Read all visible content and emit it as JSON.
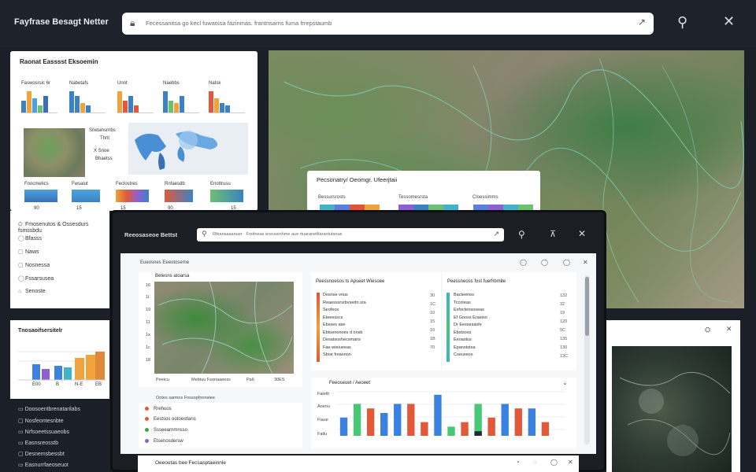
{
  "app": {
    "title": "Fayfrase Besagt Netter"
  },
  "search": {
    "text": "Fecessanitsa go kecl fuwatssa fazinmas. frantnsarns fuma frrepstaumb",
    "arrow": "↗"
  },
  "top_actions": {
    "search": "⚲",
    "close": "✕"
  },
  "left_panel": {
    "title": "Raonat Easssst Eksoemin",
    "mini_charts": [
      {
        "label": "Faswosrsic 6r",
        "colors": [
          "#3b82c4",
          "#f0a33a",
          "#4aa3df",
          "#6cc070",
          "#3b6fb5"
        ]
      },
      {
        "label": "Nabetafs",
        "colors": [
          "#3b82c4",
          "#3b82c4",
          "#f0a33a",
          "#3b82c4"
        ]
      },
      {
        "label": "Unnt",
        "colors": [
          "#f0a33a",
          "#e05a3a",
          "#3b82c4",
          "#e05a3a"
        ]
      },
      {
        "label": "Naebbs",
        "colors": [
          "#3b82c4",
          "#6cc070",
          "#f0a33a",
          "#3b82c4"
        ]
      },
      {
        "label": "Natsk",
        "colors": [
          "#e05a3a",
          "#f0a33a",
          "#3b82c4",
          "#3b82c4"
        ]
      }
    ],
    "map_labels": [
      "Srietansrnbs",
      "Thrit",
      "X Srioe",
      "Bhaetss"
    ],
    "bottom_labels": [
      "Fnocmetics",
      "Fwsalut",
      "Feclostres",
      "Rnfaesdb",
      "Enottrusu"
    ],
    "bottom_values": [
      "90",
      "15",
      "15",
      "90",
      "15"
    ]
  },
  "left_list": {
    "items": [
      "Fmosenutos & Ossesdurs fsmssbdu",
      "Bfasss",
      "Naws",
      "Nosnessa",
      "Fssarsusea",
      "Senoste"
    ],
    "icons": [
      "⛭",
      "◯",
      "▢",
      "▢",
      "◯",
      "⌂"
    ]
  },
  "map_popup": {
    "title": "Pecsonatry/ Oeomgr. Ufeerjtaii",
    "cols": [
      "Bessursrosts",
      "Tessomesrsta",
      "Cloessimms"
    ],
    "bars": [
      [
        "#3fb3c9",
        "#5a7fe0",
        "#e0553a",
        "#f0a33a"
      ],
      [
        "#8f5fd6",
        "#3b82c4",
        "#6cc070",
        "#3fb3c9"
      ],
      [
        "#5a7fe0",
        "#8f5fd6",
        "#3fb3c9",
        "#6cc070"
      ]
    ]
  },
  "bl_card": {
    "title": "Tnosaoifsersitelr",
    "xlabels": [
      "E00",
      "B",
      "N-E",
      "EB"
    ]
  },
  "bl_list": {
    "items": [
      "Doosoentbrenatarilabs",
      "Nosfeontesnbte",
      "Nrfsoeetssuaeobs",
      "Easnsreosstb",
      "Desnemsbessbt",
      "Easnurrfaeoseuot"
    ],
    "icons": [
      "▭",
      "▢",
      "▭",
      "▭",
      "▢",
      "▭"
    ]
  },
  "front_window": {
    "title": "Reeosaseoe Bettst",
    "search_text": "Rfeansaaanuer · Freitneas iesruusnhme aue rtuaranetfiarantutsnue",
    "actions": {
      "search": "⚲",
      "pin": "⊼",
      "close": "✕"
    },
    "breadcrumb": "Eueosnes Eeeotoseme",
    "toolbar_icons": [
      "◯",
      "◯",
      "◯",
      "✕"
    ],
    "map_card": {
      "title": "Betesns atoarsa",
      "y_ticks": [
        "16",
        "1i",
        "19",
        "11",
        "1x",
        "1c",
        "18"
      ],
      "x_ticks": [
        "Peeicu",
        "Mebtuu Fsoriaaeess",
        "Pa6",
        "30ES"
      ],
      "caption": "Ootes sarmns Fnssopfnnnstee"
    },
    "legend": [
      {
        "label": "Rrehuos",
        "color": "#e05a3a"
      },
      {
        "label": "Eestsos ootoestlans",
        "color": "#e05a3a"
      },
      {
        "label": "Ssseearnmnsso",
        "color": "#3fa34d"
      },
      {
        "label": "Etsenosdersw",
        "color": "#8f5fd6"
      }
    ],
    "list1": {
      "title": "Peessnoesos ts Apseet Wiesoee",
      "rows": [
        "Desnse vnus",
        "Reaesssrsrbvsedn.sra",
        "Seofeos",
        "Eteeesscs",
        "Ebsses ase",
        "Ebtuenonoes d onsb",
        "Desatsoshecsmans",
        "Fae·wieiueeas",
        "Sboe freasnon"
      ],
      "nums": [
        "30",
        "1C",
        "10",
        "15",
        "10",
        "1B",
        "70"
      ]
    },
    "list2": {
      "title": "Peessneoss fost fuerhbmite",
      "rows": [
        "Bacteenos",
        "Tccoteas",
        "Exfoctensoseas",
        "Ef Gooss Eraeiso",
        "Dr Eessesasfe",
        "Ebstsoss",
        "Eeoastus",
        "Epanstotsa",
        "Cseuseos"
      ],
      "nums": [
        "132",
        "32",
        "19",
        "120",
        "5C",
        "135",
        "130",
        "13C"
      ]
    },
    "chart_title": "Feeoseuet / Aeoeet",
    "chart_y": [
      "Faieth",
      "Aoenu",
      "Fiaue",
      "Fatlu"
    ],
    "bottom": {
      "title": "Oeeoutas bee Fecsasptaeinnle",
      "icons": [
        "◔",
        "◌",
        "◯",
        "✕"
      ]
    }
  },
  "br_card": {
    "gear": "⛭",
    "close": "✕"
  },
  "chart_data": {
    "type": "bar",
    "series": [
      {
        "color": "#3b82e0",
        "values": [
          4,
          0,
          0,
          5,
          7,
          0,
          0,
          9,
          0,
          0,
          0,
          0,
          7,
          0,
          6,
          0,
          0
        ]
      },
      {
        "color": "#48c774",
        "values": [
          0,
          7,
          0,
          0,
          0,
          0,
          0,
          0,
          2,
          0,
          7,
          0,
          0,
          0,
          0,
          0,
          0
        ]
      },
      {
        "color": "#e05a3a",
        "values": [
          0,
          0,
          6,
          0,
          0,
          7,
          3,
          0,
          0,
          3,
          0,
          4,
          0,
          6,
          0,
          3,
          0
        ]
      },
      {
        "color": "#1f2937",
        "values": [
          0,
          0,
          0,
          0,
          0,
          0,
          0,
          0,
          0,
          0,
          1,
          0,
          0,
          0,
          0,
          0,
          0
        ]
      }
    ],
    "ylim": [
      0,
      10
    ]
  }
}
